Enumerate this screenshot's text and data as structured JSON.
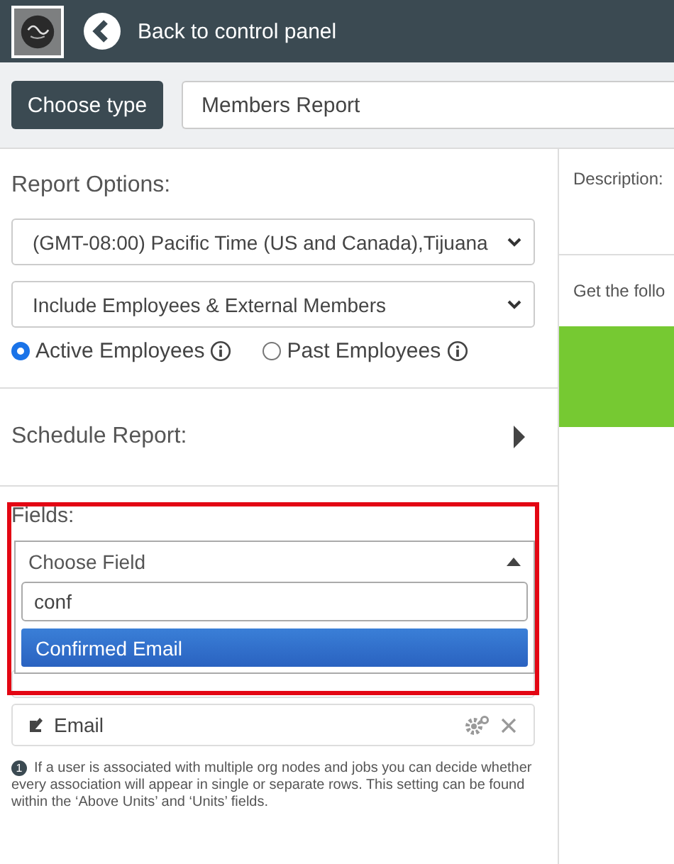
{
  "header": {
    "back_label": "Back to control panel"
  },
  "toolbar": {
    "choose_type_label": "Choose type",
    "report_type": "Members Report"
  },
  "report_options": {
    "title": "Report Options:",
    "timezone": "(GMT-08:00) Pacific Time (US and Canada),Tijuana",
    "members_filter": "Include Employees & External Members",
    "employee_status": [
      {
        "label": "Active Employees",
        "selected": true
      },
      {
        "label": "Past Employees",
        "selected": false
      }
    ]
  },
  "schedule": {
    "title": "Schedule Report:",
    "expanded": false
  },
  "fields": {
    "title": "Fields:",
    "highlighted": true,
    "chooser": {
      "placeholder": "Choose Field",
      "expanded": true,
      "search_value": "conf",
      "options": [
        {
          "label": "Confirmed Email",
          "selected": true
        }
      ]
    },
    "items": [
      {
        "kind": "covered"
      },
      {
        "kind": "field",
        "label": "Email"
      }
    ]
  },
  "footnote": {
    "marker": "1",
    "text": "If a user is associated with multiple org nodes and jobs you can decide whether every association will appear in single or separate rows. This setting can be found within the ‘Above Units’ and ‘Units’ fields."
  },
  "side": {
    "description_label": "Description:",
    "intro": "Get the follo"
  }
}
